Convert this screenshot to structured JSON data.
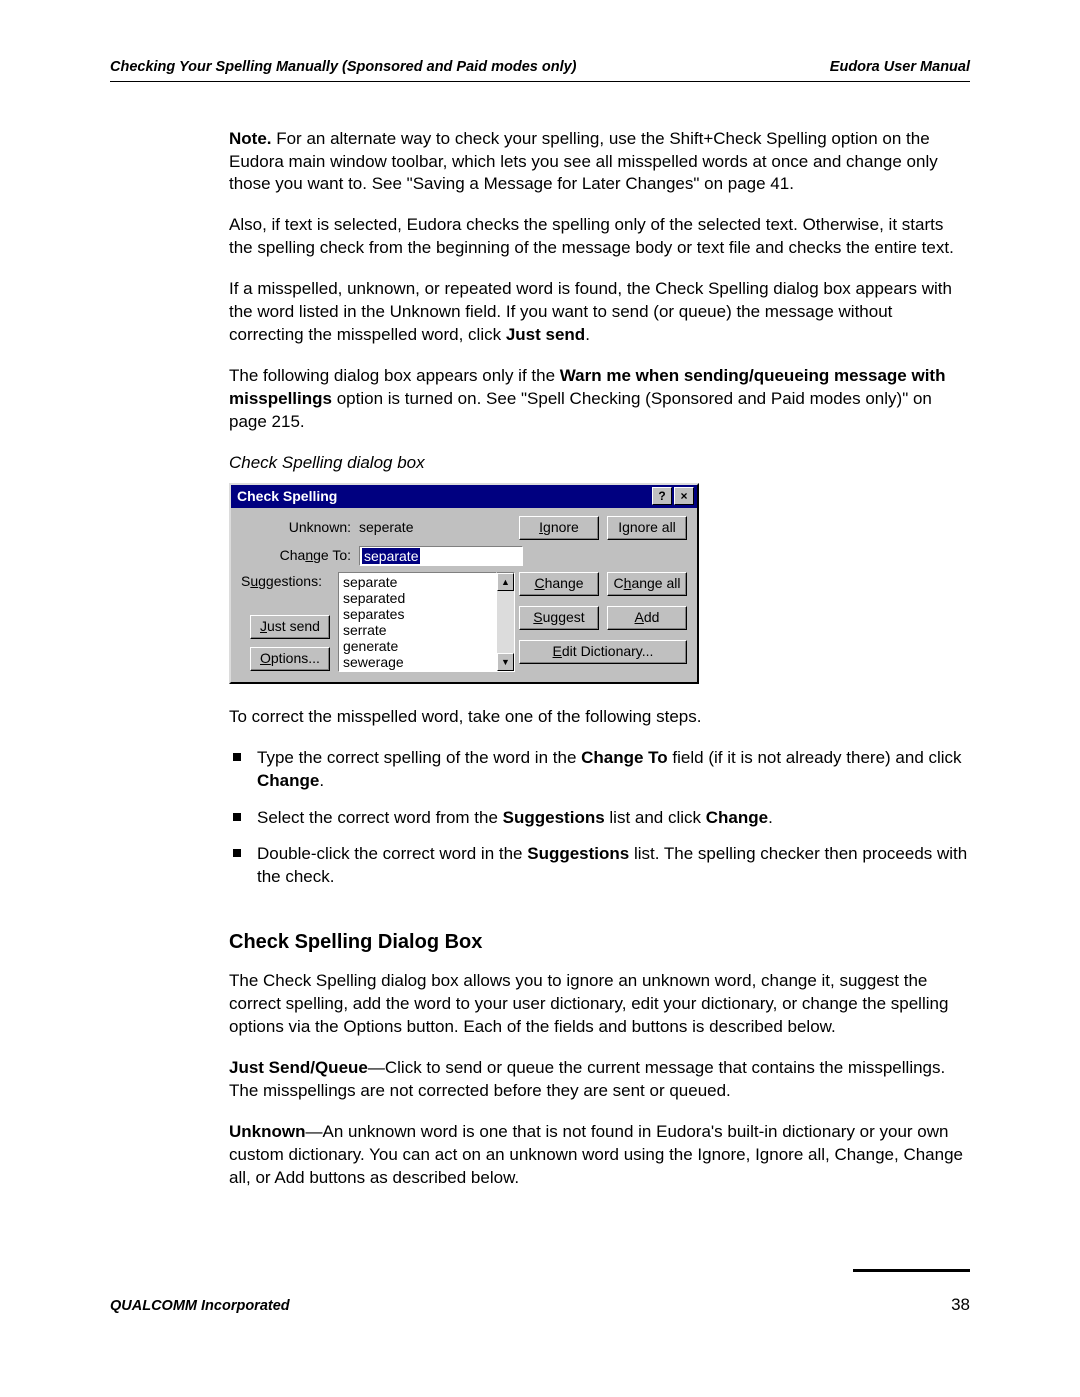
{
  "header": {
    "left": "Checking Your Spelling Manually (Sponsored and Paid modes only)",
    "right": "Eudora User Manual"
  },
  "paragraphs": {
    "note_prefix": "Note.",
    "note_rest": " For an alternate way to check your spelling, use the Shift+Check Spelling option on the Eudora main window toolbar, which lets you see all misspelled words at once and change only those you want to. See \"Saving a Message for Later Changes\" on page 41.",
    "p2": "Also, if text is selected, Eudora checks the spelling only of the selected text. Otherwise, it starts the spelling check from the beginning of the message body or text file and checks the entire text.",
    "p3_a": "If a misspelled, unknown, or repeated word is found, the Check Spelling dialog box appears with the word listed in the Unknown field. If you want to send (or queue) the message without correcting the misspelled word, click ",
    "p3_b": "Just send",
    "p3_c": ".",
    "p4_a": "The following dialog box appears only if the ",
    "p4_b": "Warn me when sending/queueing message with misspellings",
    "p4_c": " option is turned on. See \"Spell Checking (Sponsored and Paid modes only)\" on page 215.",
    "caption": "Check Spelling dialog box",
    "after1": "To correct the misspelled word, take one of the following steps.",
    "li1_a": "Type the correct spelling of the word in the ",
    "li1_b": "Change To",
    "li1_c": " field (if it is not already there) and click ",
    "li1_d": "Change",
    "li1_e": ".",
    "li2_a": "Select the correct word from the ",
    "li2_b": "Suggestions",
    "li2_c": " list and click ",
    "li2_d": "Change",
    "li2_e": ".",
    "li3_a": "Double-click the correct word in the ",
    "li3_b": "Suggestions",
    "li3_c": " list. The spelling checker then proceeds with the check.",
    "h2": "Check Spelling Dialog Box",
    "p5": "The Check Spelling dialog box allows you to ignore an unknown word, change it, suggest the correct spelling, add the word to your user dictionary, edit your dictionary, or change the spelling options via the Options button. Each of the fields and buttons is described below.",
    "p6_a": "Just Send/Queue",
    "p6_b": "—Click to send or queue the current message that contains the misspellings. The misspellings are not corrected before they are sent or queued.",
    "p7_a": "Unknown",
    "p7_b": "—An unknown word is one that is not found in Eudora's built-in dictionary or your own custom dictionary. You can act on an unknown word using the Ignore, Ignore all, Change, Change all, or Add buttons as described below."
  },
  "dialog": {
    "title": "Check Spelling",
    "labels": {
      "unknown": "Unknown:",
      "change_to": "Change To:",
      "suggestions": "Suggestions:"
    },
    "unknown_value": "seperate",
    "change_to_value": "separate",
    "suggestions_list": [
      "separate",
      "separated",
      "separates",
      "serrate",
      "generate",
      "sewerage"
    ],
    "buttons": {
      "ignore": "Ignore",
      "ignore_all": "Ignore all",
      "change": "Change",
      "change_all": "Change all",
      "suggest": "Suggest",
      "add": "Add",
      "just_send": "Just send",
      "options": "Options...",
      "edit_dictionary": "Edit Dictionary..."
    }
  },
  "footer": {
    "left": "QUALCOMM Incorporated",
    "page": "38"
  }
}
